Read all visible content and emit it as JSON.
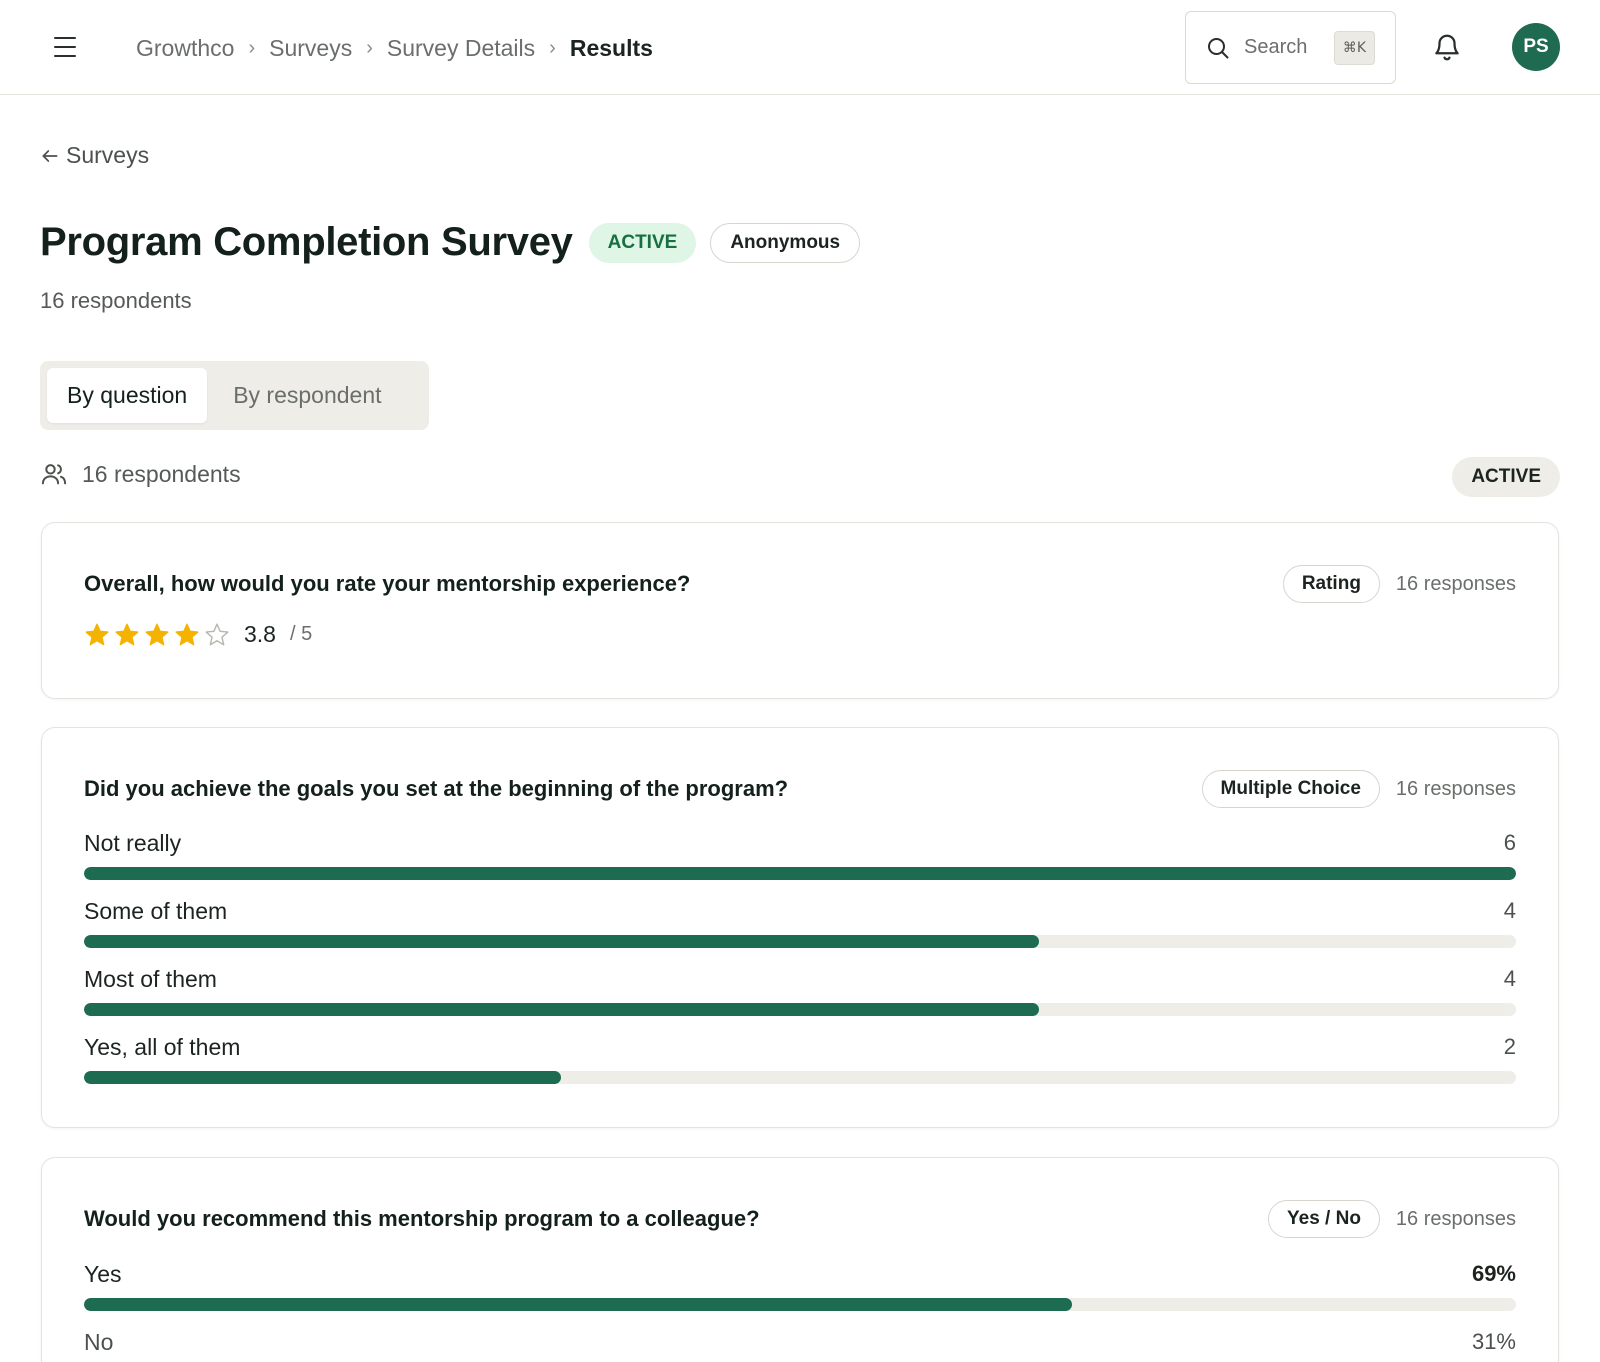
{
  "header": {
    "breadcrumb": [
      "Growthco",
      "Surveys",
      "Survey Details",
      "Results"
    ],
    "search_label": "Search",
    "search_shortcut": "⌘K",
    "avatar_initials": "PS"
  },
  "page": {
    "back_label": "Surveys",
    "title": "Program Completion Survey",
    "status_badge": "ACTIVE",
    "anonymity_badge": "Anonymous",
    "respondents_sub": "16 respondents",
    "tabs": [
      "By question",
      "By respondent"
    ],
    "active_tab": 0,
    "respondents_row": "16 respondents",
    "status_pill": "ACTIVE"
  },
  "colors": {
    "accent": "#1d6b50",
    "star": "#f5b301",
    "active_badge_bg": "#dff5e6",
    "active_badge_text": "#177040"
  },
  "questions": [
    {
      "text": "Overall, how would you rate your mentorship experience?",
      "type": "Rating",
      "responses": "16 responses",
      "rating": {
        "value": "3.8",
        "max": "/ 5",
        "stars_filled": 4,
        "stars_total": 5
      }
    },
    {
      "text": "Did you achieve the goals you set at the beginning of the program?",
      "type": "Multiple Choice",
      "responses": "16 responses",
      "options": [
        {
          "label": "Not really",
          "count": "6",
          "fraction": 1.0
        },
        {
          "label": "Some of them",
          "count": "4",
          "fraction": 0.6667
        },
        {
          "label": "Most of them",
          "count": "4",
          "fraction": 0.6667
        },
        {
          "label": "Yes, all of them",
          "count": "2",
          "fraction": 0.3333
        }
      ]
    },
    {
      "text": "Would you recommend this mentorship program to a colleague?",
      "type": "Yes / No",
      "responses": "16 responses",
      "options": [
        {
          "label": "Yes",
          "count": "69%",
          "fraction": 0.69
        },
        {
          "label": "No",
          "count": "31%",
          "fraction": 0.31
        }
      ]
    }
  ]
}
